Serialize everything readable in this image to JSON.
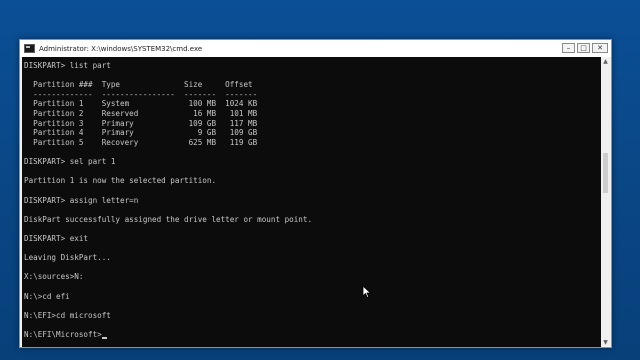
{
  "window": {
    "title": "Administrator: X:\\windows\\SYSTEM32\\cmd.exe",
    "buttons": {
      "minimize": "–",
      "maximize": "□",
      "close": "✕"
    }
  },
  "console": {
    "lines": [
      "DISKPART> list part",
      "",
      "  Partition ###  Type              Size     Offset",
      "  -------------  ----------------  -------  -------",
      "  Partition 1    System             100 MB  1024 KB",
      "  Partition 2    Reserved            16 MB   101 MB",
      "  Partition 3    Primary            109 GB   117 MB",
      "  Partition 4    Primary              9 GB   109 GB",
      "  Partition 5    Recovery           625 MB   119 GB",
      "",
      "DISKPART> sel part 1",
      "",
      "Partition 1 is now the selected partition.",
      "",
      "DISKPART> assign letter=n",
      "",
      "DiskPart successfully assigned the drive letter or mount point.",
      "",
      "DISKPART> exit",
      "",
      "Leaving DiskPart...",
      "",
      "X:\\sources>N:",
      "",
      "N:\\>cd efi",
      "",
      "N:\\EFI>cd microsoft",
      ""
    ],
    "current_prompt": "N:\\EFI\\Microsoft>"
  }
}
